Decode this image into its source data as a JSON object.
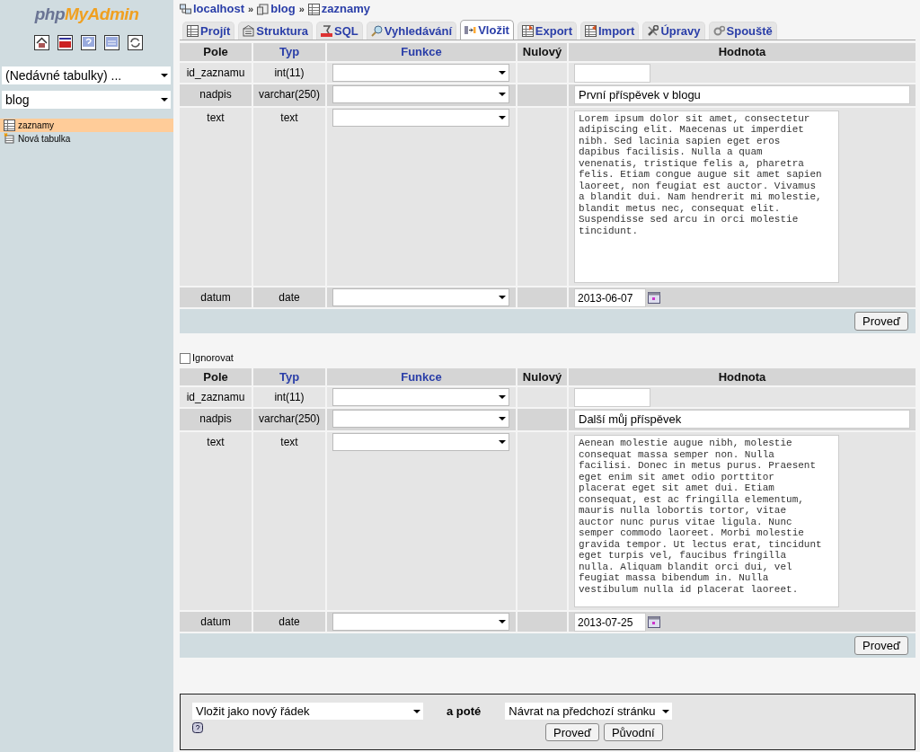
{
  "sidebar": {
    "logo": {
      "first": "php",
      "second": "MyAdmin"
    },
    "recent_tables": "(Nedávné tabulky) ...",
    "database": "blog",
    "tree": [
      {
        "label": "zaznamy",
        "kind": "table",
        "selected": true
      },
      {
        "label": "Nová tabulka",
        "kind": "new",
        "selected": false
      }
    ]
  },
  "breadcrumb": {
    "separator": "»",
    "items": [
      {
        "label": "localhost",
        "kind": "server"
      },
      {
        "label": "blog",
        "kind": "database"
      },
      {
        "label": "zaznamy",
        "kind": "table"
      }
    ]
  },
  "tabs": [
    {
      "label": "Projít",
      "kind": "browse",
      "selected": false
    },
    {
      "label": "Struktura",
      "kind": "structure",
      "selected": false
    },
    {
      "label": "SQL",
      "kind": "sql",
      "selected": false
    },
    {
      "label": "Vyhledávání",
      "kind": "search",
      "selected": false
    },
    {
      "label": "Vložit",
      "kind": "insert",
      "selected": true
    },
    {
      "label": "Export",
      "kind": "export",
      "selected": false
    },
    {
      "label": "Import",
      "kind": "import",
      "selected": false
    },
    {
      "label": "Úpravy",
      "kind": "operations",
      "selected": false
    },
    {
      "label": "Spouště",
      "kind": "triggers",
      "selected": false
    }
  ],
  "forms": [
    {
      "columns": [
        {
          "label": "Pole",
          "link": false
        },
        {
          "label": "Typ",
          "link": true
        },
        {
          "label": "Funkce",
          "link": true
        },
        {
          "label": "Nulový",
          "link": false
        },
        {
          "label": "Hodnota",
          "link": false
        }
      ],
      "rows": [
        {
          "field": "id_zaznamu",
          "type": "int(11)",
          "kind": "short"
        },
        {
          "field": "nadpis",
          "type": "varchar(250)",
          "kind": "line",
          "value": "První příspěvek v blogu"
        },
        {
          "field": "text",
          "type": "text",
          "kind": "textarea",
          "value": "Lorem ipsum dolor sit amet, consectetur adipiscing elit. Maecenas ut imperdiet nibh. Sed lacinia sapien eget eros dapibus facilisis. Nulla a quam venenatis, tristique felis a, pharetra felis. Etiam congue augue sit amet sapien laoreet, non feugiat est auctor. Vivamus a blandit dui. Nam hendrerit mi molestie, blandit metus nec, consequat elit. Suspendisse sed arcu in orci molestie tincidunt."
        },
        {
          "field": "datum",
          "type": "date",
          "kind": "date",
          "value": "2013-06-07"
        }
      ],
      "submit": "Proveď"
    },
    {
      "ignore": {
        "label": "Ignorovat",
        "checked": false
      },
      "columns": [
        {
          "label": "Pole",
          "link": false
        },
        {
          "label": "Typ",
          "link": true
        },
        {
          "label": "Funkce",
          "link": true
        },
        {
          "label": "Nulový",
          "link": false
        },
        {
          "label": "Hodnota",
          "link": false
        }
      ],
      "rows": [
        {
          "field": "id_zaznamu",
          "type": "int(11)",
          "kind": "short"
        },
        {
          "field": "nadpis",
          "type": "varchar(250)",
          "kind": "line",
          "value": "Další můj příspěvek"
        },
        {
          "field": "text",
          "type": "text",
          "kind": "textarea",
          "value": "Aenean molestie augue nibh, molestie consequat massa semper non. Nulla facilisi. Donec in metus purus. Praesent eget enim sit amet odio porttitor placerat eget sit amet dui. Etiam consequat, est ac fringilla elementum, mauris nulla lobortis tortor, vitae auctor nunc purus vitae ligula. Nunc semper commodo laoreet. Morbi molestie gravida tempor. Ut lectus erat, tincidunt eget turpis vel, faucibus fringilla nulla. Aliquam blandit orci dui, vel feugiat massa bibendum in. Nulla vestibulum nulla id placerat laoreet."
        },
        {
          "field": "datum",
          "type": "date",
          "kind": "date",
          "value": "2013-07-25"
        }
      ],
      "submit": "Proveď"
    }
  ],
  "bottom": {
    "insert_mode": "Vložit jako nový řádek",
    "then_label": "a poté",
    "after": "Návrat na předchozí stránku",
    "buttons": [
      "Proveď",
      "Původní"
    ]
  }
}
